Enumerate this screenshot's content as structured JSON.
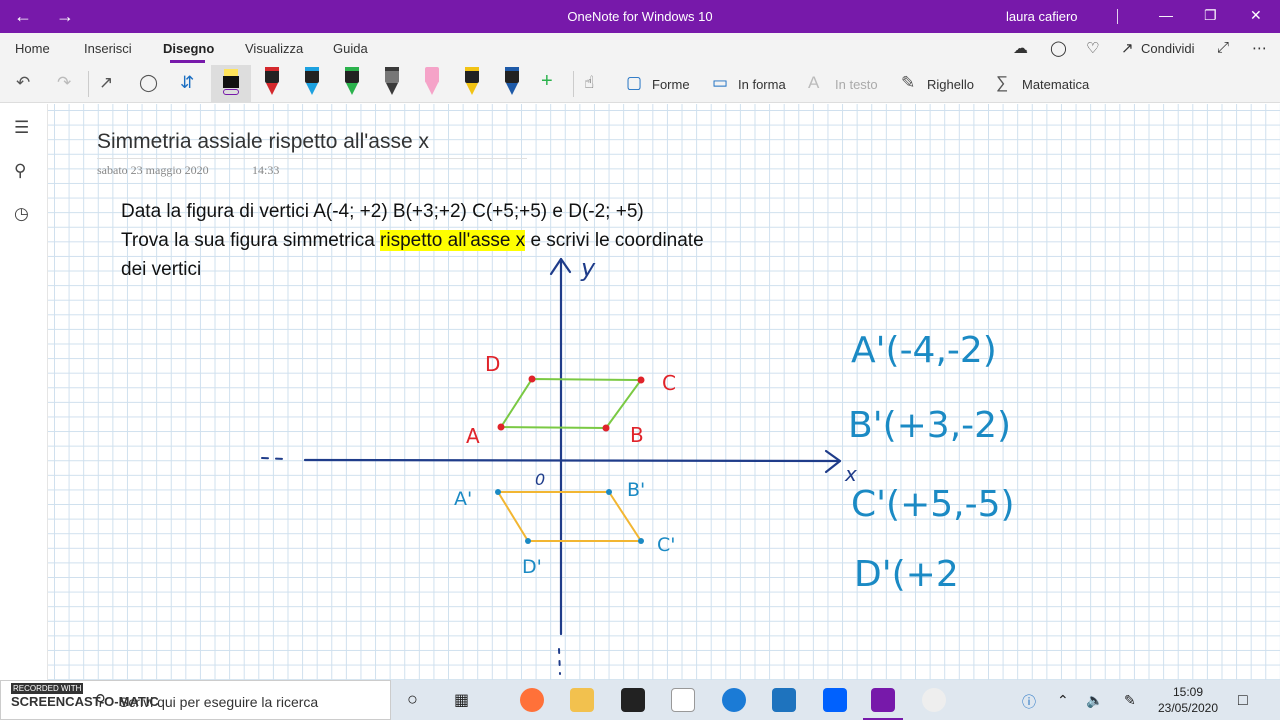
{
  "window": {
    "title": "OneNote for Windows 10",
    "user": "laura cafiero",
    "back_icon": "arrow-left-icon",
    "forward_icon": "arrow-right-icon",
    "controls": [
      "minimize-icon",
      "restore-icon",
      "close-icon"
    ]
  },
  "menu": {
    "tabs": [
      "Home",
      "Inserisci",
      "Disegno",
      "Visualizza",
      "Guida"
    ],
    "active_tab": "Disegno",
    "share_label": "Condividi",
    "right_icons": [
      "sync-icon",
      "lightbulb-icon",
      "bell-icon",
      "share-icon",
      "expand-icon",
      "more-icon"
    ]
  },
  "toolbar": {
    "forme_label": "Forme",
    "in_forma_label": "In forma",
    "in_testo_label": "In testo",
    "righello_label": "Righello",
    "matematica_label": "Matematica",
    "pen_colors": [
      "#d4282c",
      "#1ca1e0",
      "#2bb24c",
      "#3a3a3a",
      "#f5a3c8",
      "#f2c314",
      "#1e5aa8"
    ],
    "highlighter_color": "#ffe45c"
  },
  "sidebar": {
    "icons": [
      "notebooks-icon",
      "search-icon",
      "recent-icon"
    ]
  },
  "page": {
    "title": "Simmetria assiale rispetto all'asse x",
    "date": "sabato 23 maggio 2020",
    "time": "14:33",
    "line1": "Data la figura di vertici A(-4; +2) B(+3;+2) C(+5;+5) e D(-2; +5)",
    "line2_pre": "Trova la sua figura simmetrica ",
    "line2_highlight": "rispetto all'asse x",
    "line2_post": " e scrivi le coordinate",
    "line3": "dei vertici"
  },
  "drawing": {
    "axis_x_label": "x",
    "axis_y_label": "y",
    "origin_label": "0",
    "labels_original": [
      "A",
      "B",
      "C",
      "D"
    ],
    "labels_image": [
      "A'",
      "B'",
      "C'",
      "D'"
    ],
    "answers": [
      "A'(-4,-2)",
      "B'(+3,-2)",
      "C'(+5,-5)",
      "D'(+2"
    ],
    "colors": {
      "axis": "#1f3c8a",
      "original": "#7ac943",
      "reflected": "#f2b632",
      "vertex_labels": "#e0232a",
      "image_labels": "#1b8ac4",
      "answers": "#1b8ac4",
      "highlight": "#ffff00",
      "accent": "#7719aa"
    }
  },
  "taskbar": {
    "search_placeholder": "Scrivi qui per eseguire la ricerca",
    "recorded_with": "RECORDED WITH",
    "brand": "SCREENCAST-O-MATIC",
    "time": "15:09",
    "date": "23/05/2020",
    "apps": [
      "cortana-icon",
      "task-view-icon",
      "firefox-icon",
      "file-explorer-icon",
      "store-icon",
      "amazon-icon",
      "edge-icon",
      "mail-icon",
      "dropbox-icon",
      "onenote-icon",
      "recorder-icon"
    ]
  }
}
